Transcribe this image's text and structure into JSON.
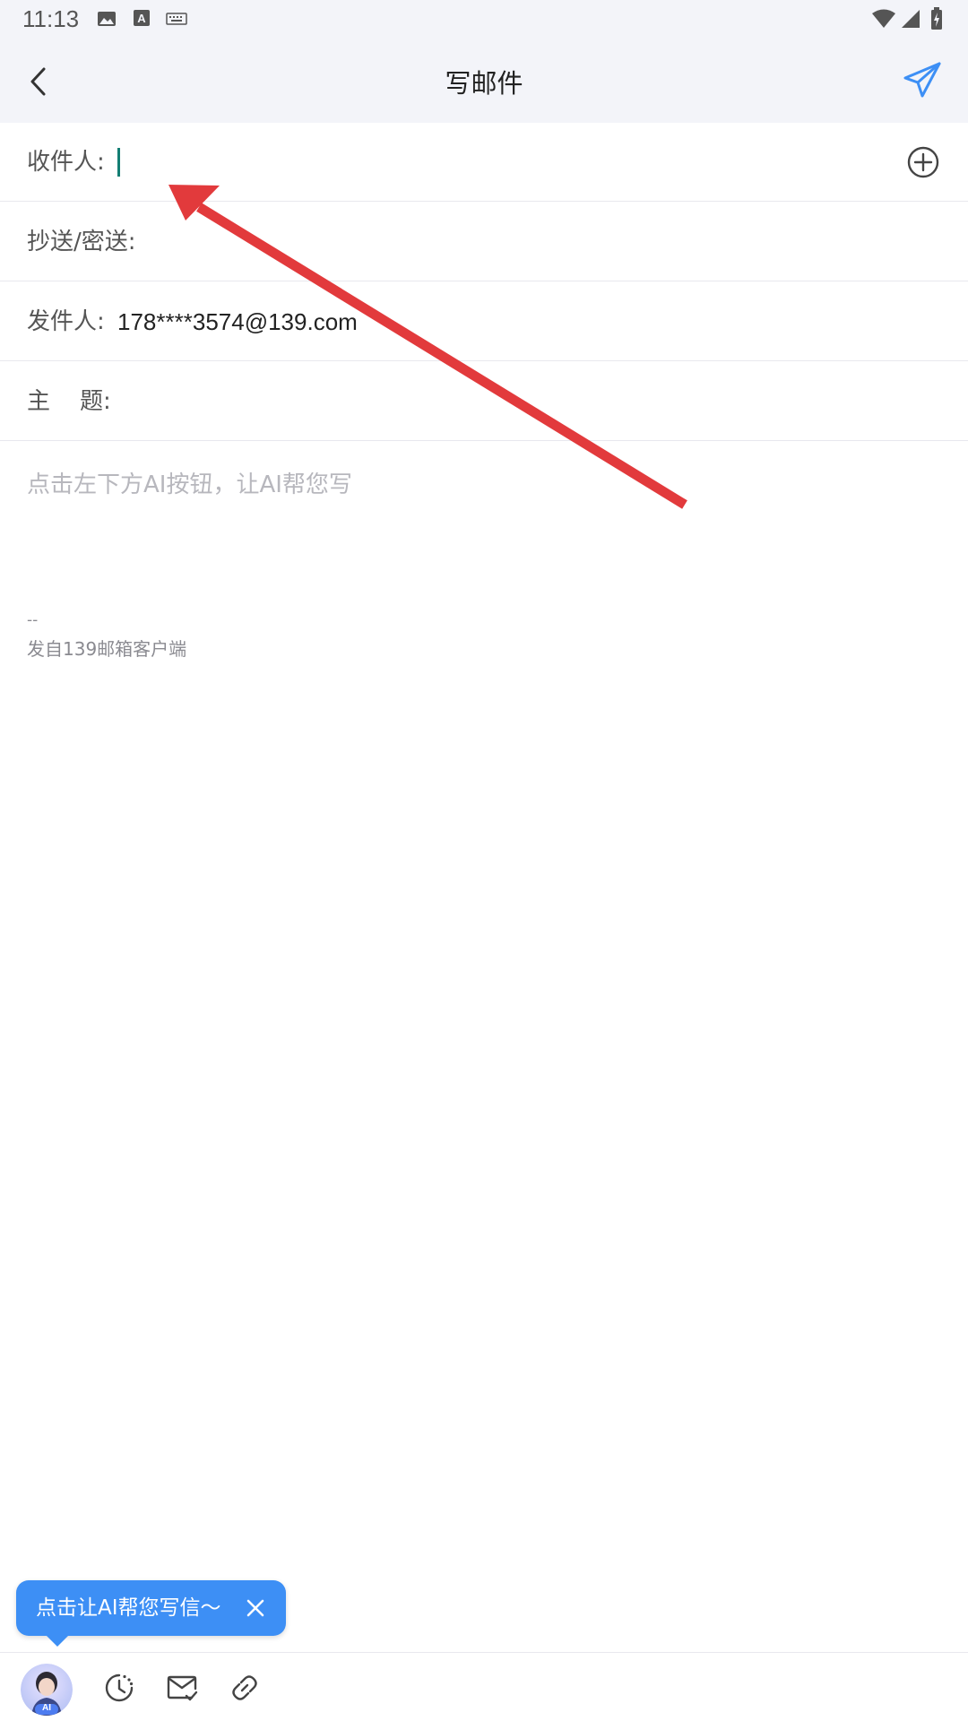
{
  "status_bar": {
    "time": "11:13",
    "icons": [
      "image-icon",
      "text-icon",
      "keyboard-icon",
      "wifi-icon",
      "signal-icon",
      "battery-icon"
    ]
  },
  "header": {
    "title": "写邮件",
    "back_icon": "chevron-left-icon",
    "send_icon": "paper-plane-icon"
  },
  "form": {
    "recipient_label": "收件人:",
    "recipient_value": "",
    "cc_bcc_label": "抄送/密送:",
    "sender_label": "发件人:",
    "sender_value": "178****3574@139.com",
    "subject_label": "主    题:",
    "subject_value": ""
  },
  "body": {
    "placeholder": "点击左下方AI按钮，让AI帮您写",
    "signature_dash": "--",
    "signature": "发自139邮箱客户端"
  },
  "ai_tip": {
    "text": "点击让AI帮您写信～"
  },
  "toolbar": {
    "ai_badge": "AI",
    "icons": [
      "ai-avatar",
      "schedule-icon",
      "mail-check-icon",
      "attachment-icon"
    ]
  },
  "colors": {
    "header_bg": "#f3f4f9",
    "accent": "#3d8ff5",
    "caret": "#137e73",
    "annotation_arrow": "#e23a3c"
  }
}
